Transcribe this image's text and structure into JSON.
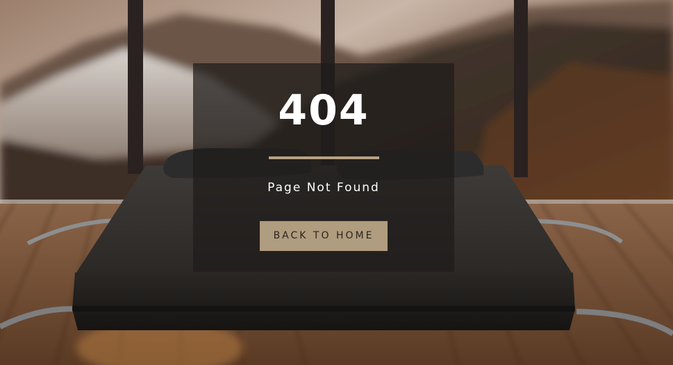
{
  "error": {
    "code": "404",
    "message": "Page Not Found"
  },
  "actions": {
    "back_home_label": "BACK TO HOME"
  },
  "colors": {
    "accent": "#b8a283",
    "button_bg": "#b09c7e",
    "overlay": "#1e1c1b"
  }
}
